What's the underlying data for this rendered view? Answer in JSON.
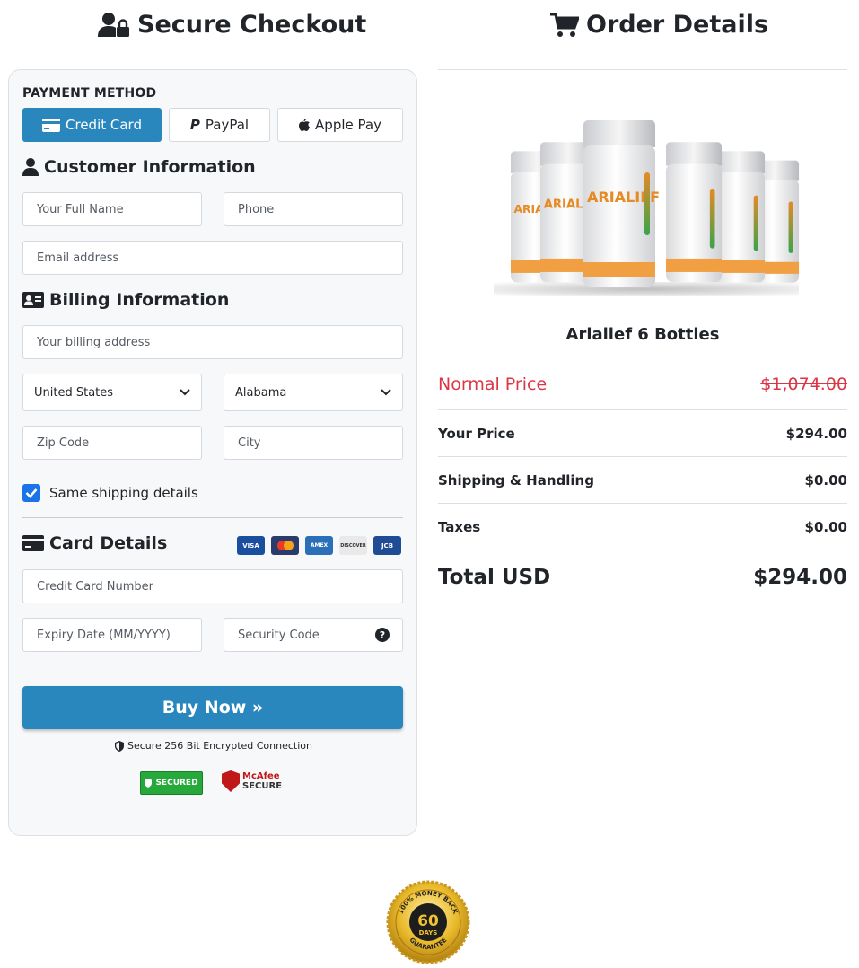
{
  "left_heading": "Secure Checkout",
  "right_heading": "Order Details",
  "payment": {
    "label": "PAYMENT METHOD",
    "methods": [
      {
        "label": "Credit Card",
        "active": true
      },
      {
        "label": "PayPal",
        "active": false
      },
      {
        "label": "Apple Pay",
        "active": false
      }
    ]
  },
  "customer": {
    "title": "Customer Information",
    "full_name_placeholder": "Your Full Name",
    "phone_placeholder": "Phone",
    "email_placeholder": "Email address"
  },
  "billing": {
    "title": "Billing Information",
    "address_placeholder": "Your billing address",
    "country": "United States",
    "state": "Alabama",
    "zip_placeholder": "Zip Code",
    "city_placeholder": "City",
    "same_shipping_label": "Same shipping details",
    "same_shipping_checked": true
  },
  "card": {
    "title": "Card Details",
    "brands": [
      "VISA",
      "MC",
      "AMEX",
      "DISCOVER",
      "JCB"
    ],
    "number_placeholder": "Credit Card Number",
    "expiry_placeholder": "Expiry Date (MM/YYYY)",
    "cvv_placeholder": "Security Code",
    "help": "?"
  },
  "buy_button": "Buy Now »",
  "secure_text": "Secure 256 Bit Encrypted Connection",
  "badges": {
    "trust": "SECURED",
    "mcafee_top": "McAfee",
    "mcafee_bottom": "SECURE"
  },
  "product": {
    "name": "Arialief 6 Bottles",
    "bottle_label": "ARIALIEF"
  },
  "prices": {
    "normal_label": "Normal Price",
    "normal_value": "$1,074.00",
    "your_label": "Your Price",
    "your_value": "$294.00",
    "shipping_label": "Shipping & Handling",
    "shipping_value": "$0.00",
    "taxes_label": "Taxes",
    "taxes_value": "$0.00",
    "total_label": "Total USD",
    "total_value": "$294.00"
  },
  "guarantee": {
    "top": "100% MONEY BACK",
    "days": "60",
    "days_word": "DAYS",
    "bottom": "GUARANTEE"
  },
  "colors": {
    "accent": "#2a87bd",
    "danger": "#dc3545",
    "checkbox": "#1a73e8"
  }
}
